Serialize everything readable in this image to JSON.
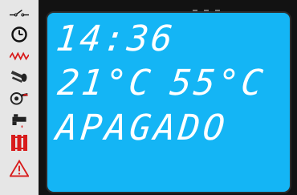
{
  "sidebar": {
    "icons": [
      {
        "name": "switch-icon",
        "color": "#111111"
      },
      {
        "name": "clock-icon",
        "color": "#111111"
      },
      {
        "name": "heat-wave-icon",
        "color": "#d81b1b"
      },
      {
        "name": "pipe-icon",
        "color": "#222222"
      },
      {
        "name": "fan-burner-icon",
        "color": "#222222"
      },
      {
        "name": "faucet-icon",
        "color": "#222222"
      },
      {
        "name": "radiator-icon",
        "color": "#d81b1b"
      },
      {
        "name": "warning-icon",
        "color": "#d81b1b"
      }
    ]
  },
  "display": {
    "time": "14:36",
    "temperature_1": "21°C",
    "temperature_2": "55°C",
    "status": "APAGADO"
  },
  "colors": {
    "screen": "#14b5f5",
    "segment": "#ffffff",
    "accent_red": "#d81b1b"
  }
}
